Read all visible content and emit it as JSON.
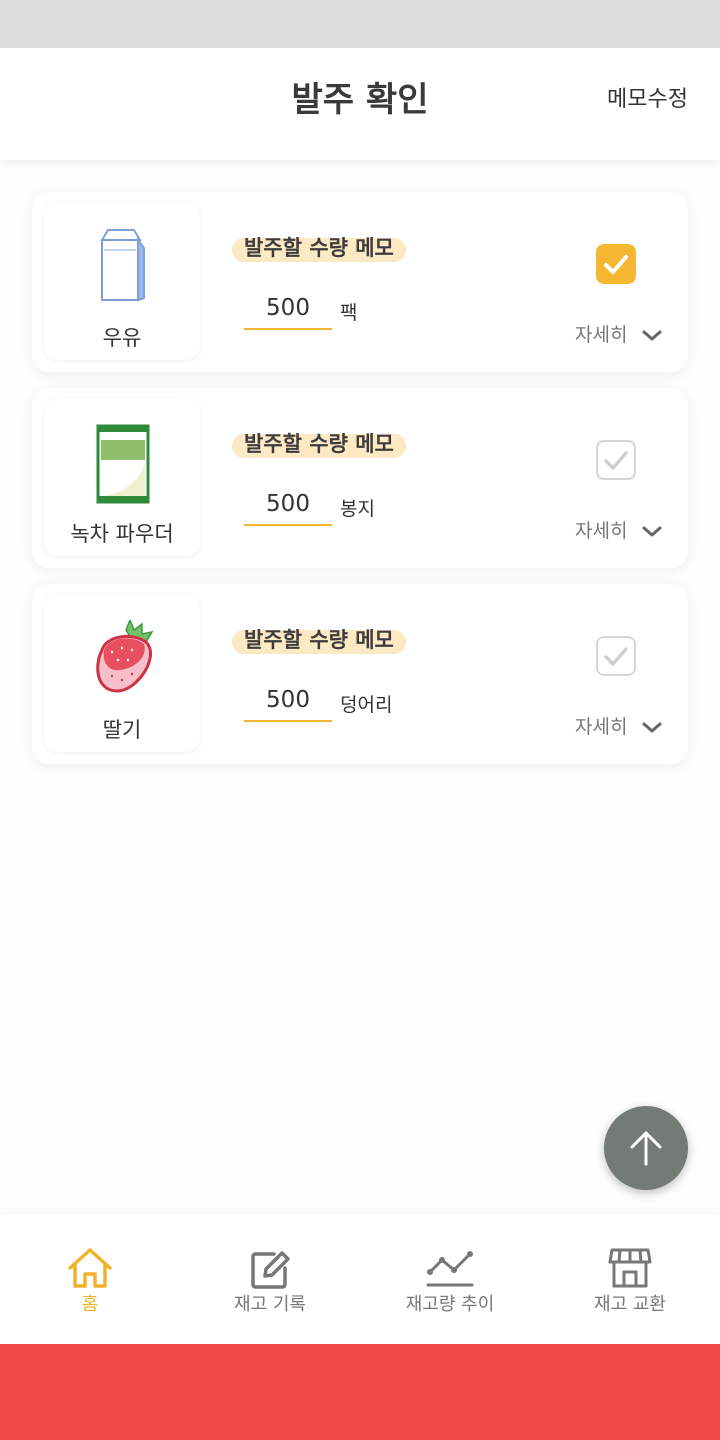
{
  "header": {
    "title": "발주 확인",
    "action_label": "메모수정"
  },
  "orders": [
    {
      "product": "우유",
      "icon": "milk-carton-icon",
      "memo_label": "발주할 수량 메모",
      "quantity": "500",
      "unit": "팩",
      "checked": true,
      "detail_label": "자세히"
    },
    {
      "product": "녹차 파우더",
      "icon": "green-tea-powder-pack-icon",
      "memo_label": "발주할 수량 메모",
      "quantity": "500",
      "unit": "봉지",
      "checked": false,
      "detail_label": "자세히"
    },
    {
      "product": "딸기",
      "icon": "strawberry-icon",
      "memo_label": "발주할 수량 메모",
      "quantity": "500",
      "unit": "덩어리",
      "checked": false,
      "detail_label": "자세히"
    }
  ],
  "fab": {
    "icon": "arrow-up-icon"
  },
  "bottom_nav": {
    "items": [
      {
        "label": "홈",
        "icon": "home-icon",
        "active": true
      },
      {
        "label": "재고 기록",
        "icon": "edit-icon",
        "active": false
      },
      {
        "label": "재고량 추이",
        "icon": "line-chart-icon",
        "active": false
      },
      {
        "label": "재고 교환",
        "icon": "store-icon",
        "active": false
      }
    ]
  },
  "colors": {
    "accent": "#f5b731",
    "memo_highlight": "#fde9c4",
    "fab": "#747a74",
    "footer_bar": "#ef4b4b",
    "status_bar": "#dcdcdc"
  }
}
